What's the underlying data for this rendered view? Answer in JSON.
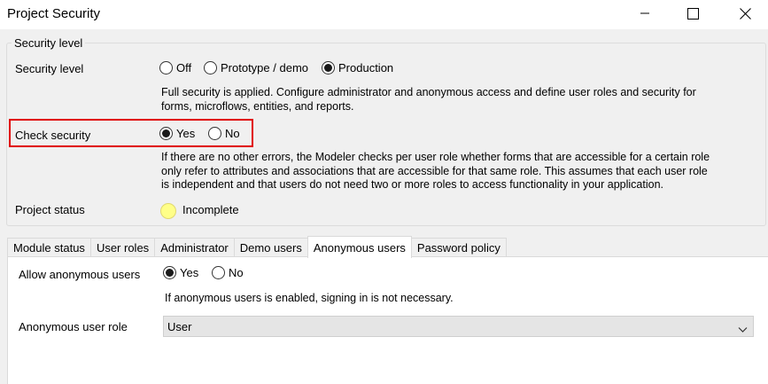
{
  "window": {
    "title": "Project Security"
  },
  "security_level": {
    "group_label": "Security level",
    "label": "Security level",
    "options": [
      {
        "label": "Off",
        "selected": false
      },
      {
        "label": "Prototype / demo",
        "selected": false
      },
      {
        "label": "Production",
        "selected": true
      }
    ],
    "description_line1": "Full security is applied. Configure administrator and anonymous access and define user roles and security for",
    "description_line2": "forms, microflows, entities, and reports."
  },
  "check_security": {
    "label": "Check security",
    "options": [
      {
        "label": "Yes",
        "selected": true
      },
      {
        "label": "No",
        "selected": false
      }
    ],
    "description_line1": "If there are no other errors, the Modeler checks per user role whether forms that are accessible for a certain role",
    "description_line2": "only refer to attributes and associations that are accessible for that same role. This assumes that each user role",
    "description_line3": "is independent and that users do not need two or more roles to access functionality in your application."
  },
  "project_status": {
    "label": "Project status",
    "value": "Incomplete",
    "indicator_color": "#ffff88"
  },
  "tabs": [
    {
      "label": "Module status",
      "active": false
    },
    {
      "label": "User roles",
      "active": false
    },
    {
      "label": "Administrator",
      "active": false
    },
    {
      "label": "Demo users",
      "active": false
    },
    {
      "label": "Anonymous users",
      "active": true
    },
    {
      "label": "Password policy",
      "active": false
    }
  ],
  "anonymous": {
    "allow_label": "Allow anonymous users",
    "options": [
      {
        "label": "Yes",
        "selected": true
      },
      {
        "label": "No",
        "selected": false
      }
    ],
    "hint": "If anonymous users is enabled, signing in is not necessary.",
    "role_label": "Anonymous user role",
    "role_value": "User"
  },
  "colors": {
    "highlight_border": "#e00000"
  }
}
